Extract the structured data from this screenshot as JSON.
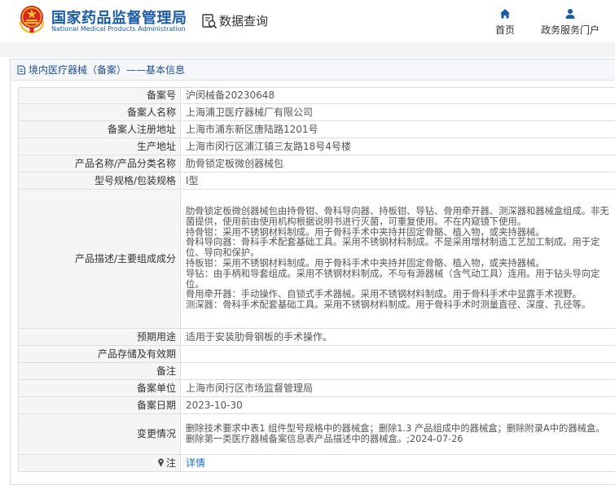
{
  "header": {
    "title": "国家药品监督管理局",
    "subtitle": "National Medical Products Administration",
    "data_query": "数据查询",
    "nav": [
      {
        "label": "首页",
        "icon": "home-icon"
      },
      {
        "label": "政务服务门户",
        "icon": "user-icon"
      }
    ]
  },
  "panel": {
    "title": "境内医疗器械（备案）——基本信息"
  },
  "record": {
    "labels": {
      "record_no": "备案号",
      "registrant": "备案人名称",
      "registrant_address": "备案人注册地址",
      "production_address": "生产地址",
      "product_name": "产品名称/产品分类名称",
      "model_spec": "型号规格/包装规格",
      "description": "产品描述/主要组成成分",
      "intended_use": "预期用途",
      "storage": "产品存储及有效期",
      "remarks": "备注",
      "record_unit": "备案单位",
      "record_date": "备案日期",
      "changes": "变更情况",
      "note": "注"
    },
    "values": {
      "record_no": "沪闵械备20230648",
      "registrant": "上海浦卫医疗器械厂有限公司",
      "registrant_address": "上海市浦东新区唐陆路1201号",
      "production_address": "上海市闵行区浦江镇三友路18号4号楼",
      "product_name": "肋骨锁定板微创器械包",
      "model_spec": "Ⅰ型",
      "description": [
        "肋骨锁定板微创器械包由持骨钳、骨科导向器、持板钳、导钻、骨用牵开器、测深器和器械盒组成。非无菌提供，使用前由使用机构根据说明书进行灭菌，可重复使用。不在内窥镜下使用。",
        "持骨钳：采用不锈钢材料制成。用于骨科手术中夹持并固定骨骼、植入物，或夹持器械。",
        "骨科导向器：骨科手术配套基础工具。采用不锈钢材料制成。不是采用增材制造工艺加工制成。用于定位、导向和保护。",
        "持板钳：采用不锈钢材料制成。用于骨科手术中夹持并固定骨骼、植入物，或夹持器械。",
        "导钻：由手柄和导套组成。采用不锈钢材料制成。不与有源器械（含气动工具）连用。用于钻头导向定位。",
        "骨用牵开器：手动操作、自锁式手术器械。采用不锈钢材料制成。用于骨科手术中显露手术视野。",
        "测深器：骨科手术配套基础工具。采用不锈钢材料制成。用于骨科手术时测量直径、深度、孔径等。"
      ],
      "intended_use": "适用于安装肋骨钢板的手术操作。",
      "storage": "",
      "remarks": "",
      "record_unit": "上海市闵行区市场监督管理局",
      "record_date": "2023-10-30",
      "changes": [
        "删除技术要求中表1 组件型号规格中的器械盒；删除1.3 产品组成中的器械盒；删除附录A中的器械盒。",
        "删除第一类医疗器械备案信息表产品描述中的器械盒。;2024-07-26"
      ],
      "note_link": "详情"
    }
  },
  "colors": {
    "brand_blue": "#1a5ba5",
    "emblem_red": "#d7261e",
    "emblem_gold": "#f2c12e",
    "link_blue": "#1a6fc4"
  }
}
